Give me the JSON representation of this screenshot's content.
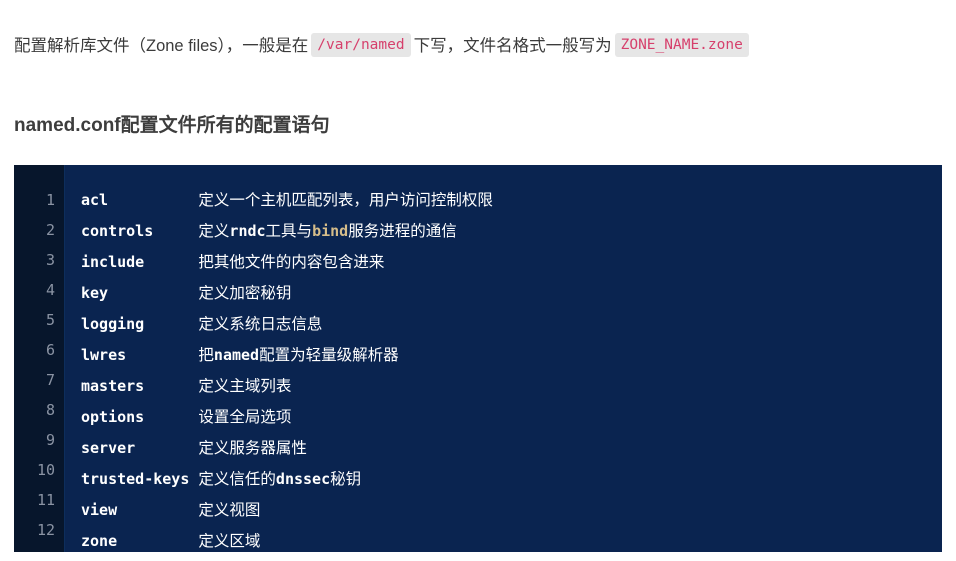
{
  "intro": {
    "seg1": "配置解析库文件（Zone files），一般是在",
    "code1": "/var/named",
    "seg2": "下写，文件名格式一般写为",
    "code2": "ZONE_NAME.zone"
  },
  "heading": {
    "text": "named.conf配置文件所有的配置语句"
  },
  "code_block": {
    "language": "text",
    "gutter_color": "#07162c",
    "background_color": "#0a2450",
    "text_color": "#ffffff",
    "highlight_color": "#d6bd8a",
    "line_numbers": [
      "1",
      "2",
      "3",
      "4",
      "5",
      "6",
      "7",
      "8",
      "9",
      "10",
      "11",
      "12"
    ],
    "lines": [
      {
        "n": "1",
        "keyword": "acl",
        "pad": "          ",
        "desc_pre": "定义一个主机匹配列表，用户访问控制权限",
        "desc_hl": "",
        "desc_post": ""
      },
      {
        "n": "2",
        "keyword": "controls",
        "pad": "     ",
        "desc_pre": "定义",
        "desc_mono": "rndc",
        "desc_mid": "工具与",
        "desc_hl": "bind",
        "desc_post": "服务进程的通信"
      },
      {
        "n": "3",
        "keyword": "include",
        "pad": "      ",
        "desc_pre": "把其他文件的内容包含进来",
        "desc_hl": "",
        "desc_post": ""
      },
      {
        "n": "4",
        "keyword": "key",
        "pad": "          ",
        "desc_pre": "定义加密秘钥",
        "desc_hl": "",
        "desc_post": ""
      },
      {
        "n": "5",
        "keyword": "logging",
        "pad": "      ",
        "desc_pre": "定义系统日志信息",
        "desc_hl": "",
        "desc_post": ""
      },
      {
        "n": "6",
        "keyword": "lwres",
        "pad": "        ",
        "desc_pre": "把",
        "desc_mono": "named",
        "desc_mid": "配置为轻量级解析器",
        "desc_hl": "",
        "desc_post": ""
      },
      {
        "n": "7",
        "keyword": "masters",
        "pad": "      ",
        "desc_pre": "定义主域列表",
        "desc_hl": "",
        "desc_post": ""
      },
      {
        "n": "8",
        "keyword": "options",
        "pad": "      ",
        "desc_pre": "设置全局选项",
        "desc_hl": "",
        "desc_post": ""
      },
      {
        "n": "9",
        "keyword": "server",
        "pad": "       ",
        "desc_pre": "定义服务器属性",
        "desc_hl": "",
        "desc_post": ""
      },
      {
        "n": "10",
        "keyword": "trusted-keys",
        "pad": " ",
        "desc_pre": "定义信任的",
        "desc_mono": "dnssec",
        "desc_mid": "秘钥",
        "desc_hl": "",
        "desc_post": ""
      },
      {
        "n": "11",
        "keyword": "view",
        "pad": "         ",
        "desc_pre": "定义视图",
        "desc_hl": "",
        "desc_post": ""
      },
      {
        "n": "12",
        "keyword": "zone",
        "pad": "         ",
        "desc_pre": "定义区域",
        "desc_hl": "",
        "desc_post": ""
      }
    ]
  }
}
